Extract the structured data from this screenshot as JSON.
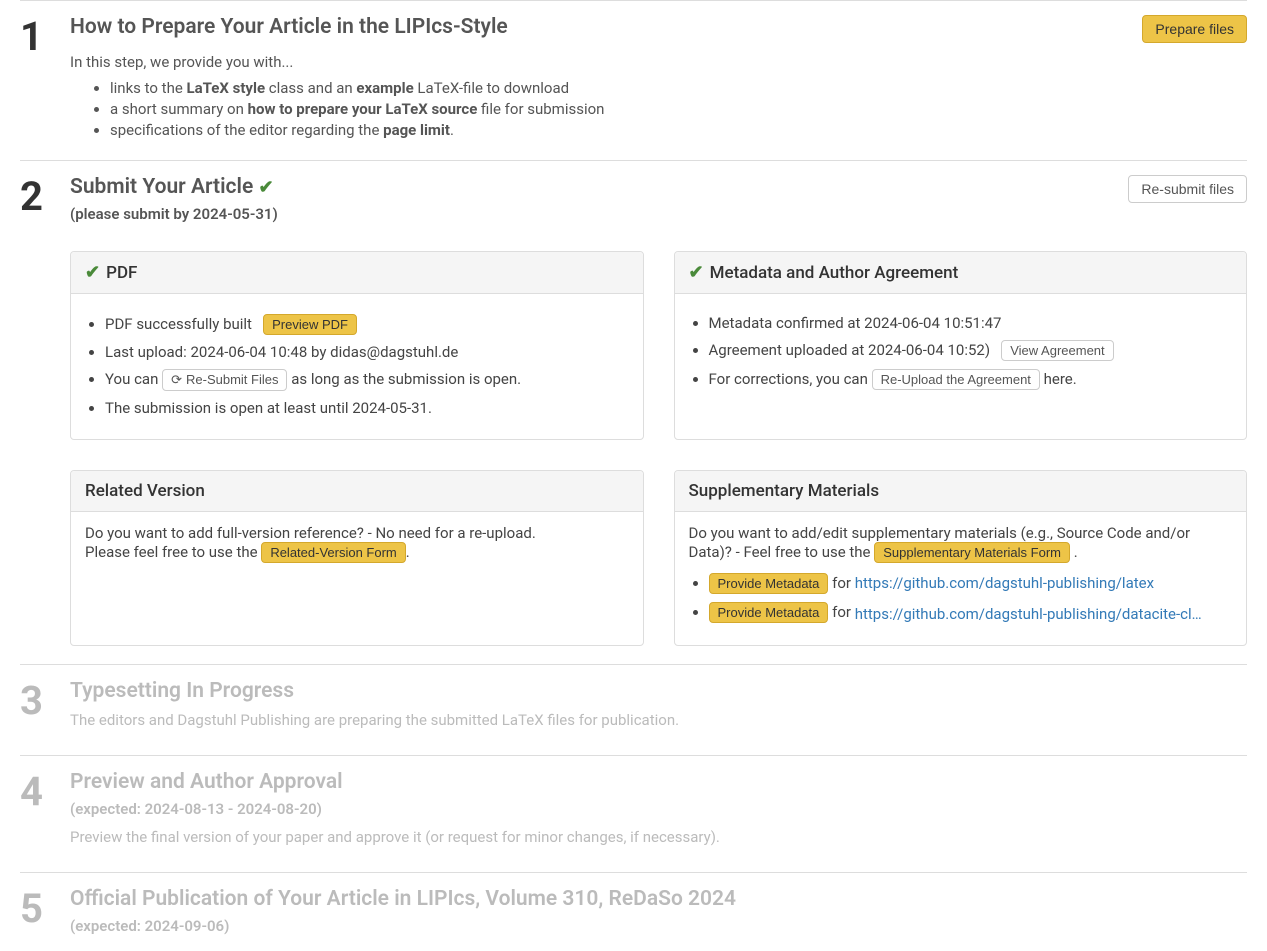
{
  "step1": {
    "num": "1",
    "title": "How to Prepare Your Article in the LIPIcs-Style",
    "button": "Prepare files",
    "intro": "In this step, we provide you with...",
    "bullets": {
      "b1_pre": "links to the ",
      "b1_bold1": "LaTeX style",
      "b1_mid": " class and an ",
      "b1_bold2": "example",
      "b1_post": " LaTeX-file to download",
      "b2_pre": "a short summary on ",
      "b2_bold": "how to prepare your LaTeX source",
      "b2_post": " file for submission",
      "b3_pre": "specifications of the editor regarding the ",
      "b3_bold": "page limit",
      "b3_post": "."
    }
  },
  "step2": {
    "num": "2",
    "title": "Submit Your Article ",
    "subtitle": "(please submit by 2024-05-31)",
    "button": "Re-submit files",
    "pdf": {
      "heading": "PDF",
      "b1_text": "PDF successfully built",
      "b1_btn": "Preview PDF",
      "b2": "Last upload: 2024-06-04 10:48 by didas@dagstuhl.de",
      "b3_pre": "You can ",
      "b3_btn": "Re-Submit Files",
      "b3_post": " as long as the submission is open.",
      "b4": "The submission is open at least until 2024-05-31."
    },
    "meta": {
      "heading": "Metadata and Author Agreement",
      "b1": "Metadata confirmed at 2024-06-04 10:51:47",
      "b2_pre": "Agreement uploaded at 2024-06-04 10:52)",
      "b2_btn": "View Agreement",
      "b3_pre": "For corrections, you can ",
      "b3_btn": "Re-Upload the Agreement",
      "b3_post": " here."
    },
    "related": {
      "heading": "Related Version",
      "line1": "Do you want to add full-version reference? - No need for a re-upload.",
      "line2_pre": "Please feel free to use the ",
      "line2_btn": "Related-Version Form",
      "line2_post": "."
    },
    "supp": {
      "heading": "Supplementary Materials",
      "intro_pre": "Do you want to add/edit supplementary materials (e.g., Source Code and/or Data)? - Feel free to use the ",
      "intro_btn": "Supplementary Materials Form",
      "intro_post": " .",
      "item1_btn": "Provide Metadata",
      "item1_for": " for ",
      "item1_link": "https://github.com/dagstuhl-publishing/latex",
      "item2_btn": "Provide Metadata",
      "item2_for": " for ",
      "item2_link": "https://github.com/dagstuhl-publishing/datacite-cli…"
    }
  },
  "step3": {
    "num": "3",
    "title": "Typesetting In Progress",
    "desc": "The editors and Dagstuhl Publishing are preparing the submitted LaTeX files for publication."
  },
  "step4": {
    "num": "4",
    "title": "Preview and Author Approval",
    "subtitle": "(expected: 2024-08-13 - 2024-08-20)",
    "desc": "Preview the final version of your paper and approve it (or request for minor changes, if necessary)."
  },
  "step5": {
    "num": "5",
    "title": "Official Publication of Your Article in LIPIcs, Volume 310, ReDaSo 2024",
    "subtitle": "(expected: 2024-09-06)"
  }
}
